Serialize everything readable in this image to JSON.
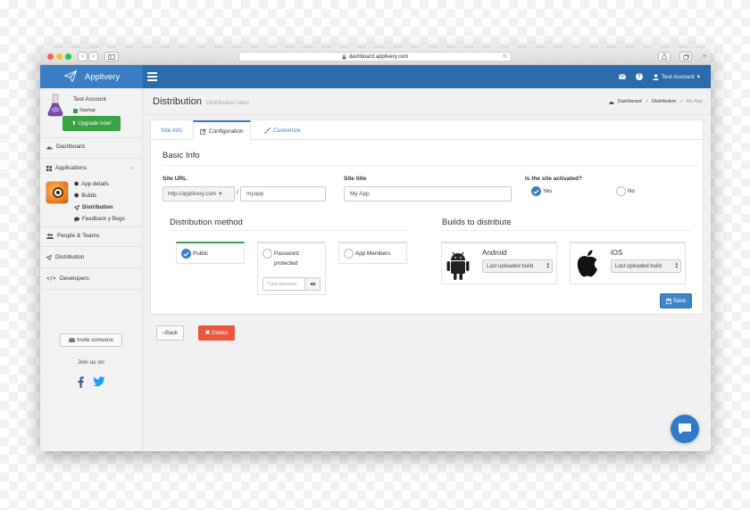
{
  "browser": {
    "url": "dashboard.applivery.com"
  },
  "navbar": {
    "brand": "Applivery",
    "account": "Test Account"
  },
  "sidebar": {
    "user_name": "Test Account",
    "user_plan": "Startup",
    "upgrade_label": "Upgrade now!",
    "dashboard": "Dashboard",
    "applications": "Applications",
    "sub_items": {
      "app_details": "App details",
      "builds": "Builds",
      "distribution": "Distribution",
      "feedback": "Feedback y Bugs"
    },
    "people": "People & Teams",
    "distribution": "Distribution",
    "developers": "Developers",
    "invite_label": "Invite someone",
    "join_us": "Join us on:"
  },
  "page": {
    "title": "Distribution",
    "subtitle": "Distribution sites",
    "breadcrumb": {
      "dashboard": "Dashboard",
      "distribution": "Distribution",
      "current": "My App",
      "sep": ">"
    }
  },
  "tabs": {
    "site_info": "Site Info",
    "configuration": "Configuration",
    "customize": "Customize"
  },
  "basic_info": {
    "heading": "Basic Info",
    "site_url_label": "Site URL",
    "url_prefix": "http://applivery.com",
    "url_slash": "/",
    "url_slug": "myapp",
    "site_title_label": "Site title",
    "site_title_value": "My App",
    "activated_label": "Is the site activated?",
    "yes": "Yes",
    "no": "No"
  },
  "distribution_method": {
    "heading": "Distribution method",
    "public": "Public",
    "password_line1": "Password",
    "password_line2": "protected",
    "password_placeholder": "Type passwor",
    "app_members": "App Members"
  },
  "builds": {
    "heading": "Builds to distribute",
    "android": "Android",
    "android_build": "Last uploaded build",
    "ios": "iOS",
    "ios_build": "Last uploaded build"
  },
  "buttons": {
    "save": "Save",
    "back": "Back",
    "delete": "Delete"
  },
  "colors": {
    "navbar": "#2b6aab",
    "brand": "#3b7ec4",
    "green": "#3aa145",
    "danger": "#e9573f"
  }
}
